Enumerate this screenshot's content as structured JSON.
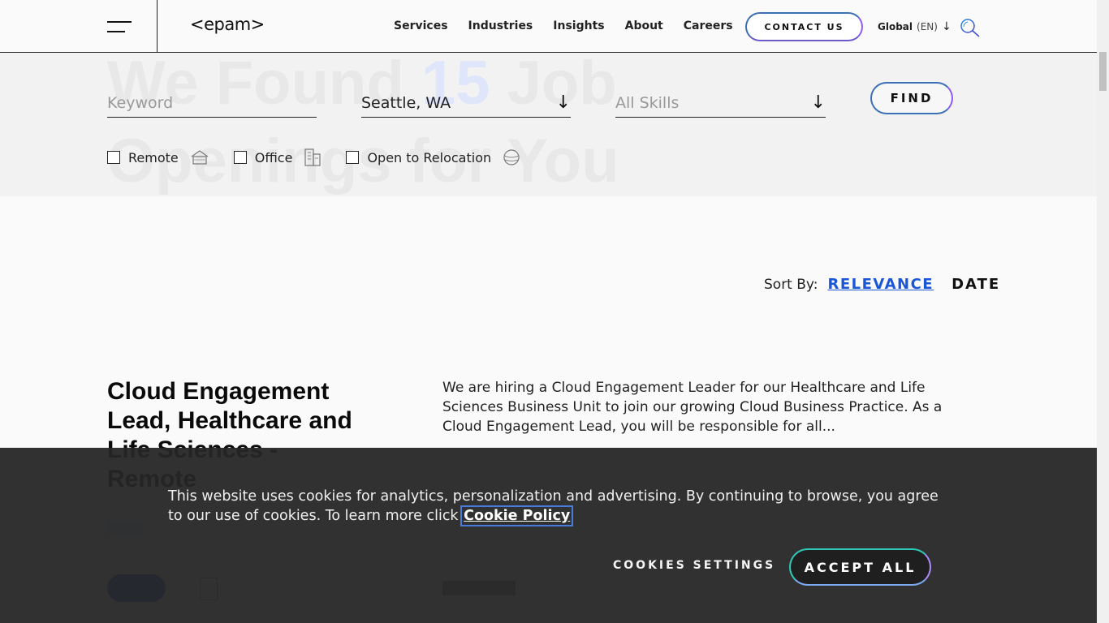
{
  "header": {
    "logo": "<epam>",
    "nav": [
      "Services",
      "Industries",
      "Insights",
      "About",
      "Careers"
    ],
    "contact_label": "CONTACT US",
    "lang_label": "Global",
    "lang_code": "(EN)"
  },
  "search": {
    "keyword_placeholder": "Keyword",
    "location_value": "Seattle, WA",
    "skills_placeholder": "All Skills",
    "find_label": "FIND",
    "filters": [
      {
        "label": "Remote",
        "icon": "house-icon",
        "checked": false
      },
      {
        "label": "Office",
        "icon": "building-icon",
        "checked": false
      },
      {
        "label": "Open to Relocation",
        "icon": "globe-icon",
        "checked": false
      }
    ]
  },
  "sort": {
    "label": "Sort By:",
    "relevance": "RELEVANCE",
    "date": "DATE"
  },
  "job": {
    "title": "Cloud Engagement Lead, Healthcare and Life Sciences - Remote",
    "description": "We are hiring a Cloud Engagement Leader for our Healthcare and Life Sciences Business Unit to join our growing Cloud Business Practice. As a Cloud Engagement Lead, you will be responsible for all..."
  },
  "cookie": {
    "text": "This website uses cookies for analytics, personalization and advertising. By continuing to browse, you agree to our use of cookies. To learn more click ",
    "policy_link": "Cookie Policy",
    "settings_label": "COOKIES SETTINGS",
    "accept_label": "ACCEPT ALL"
  },
  "colors": {
    "accent_blue": "#1a56d8",
    "gradient_start": "#2ec7b8",
    "gradient_end": "#a98bf5"
  }
}
